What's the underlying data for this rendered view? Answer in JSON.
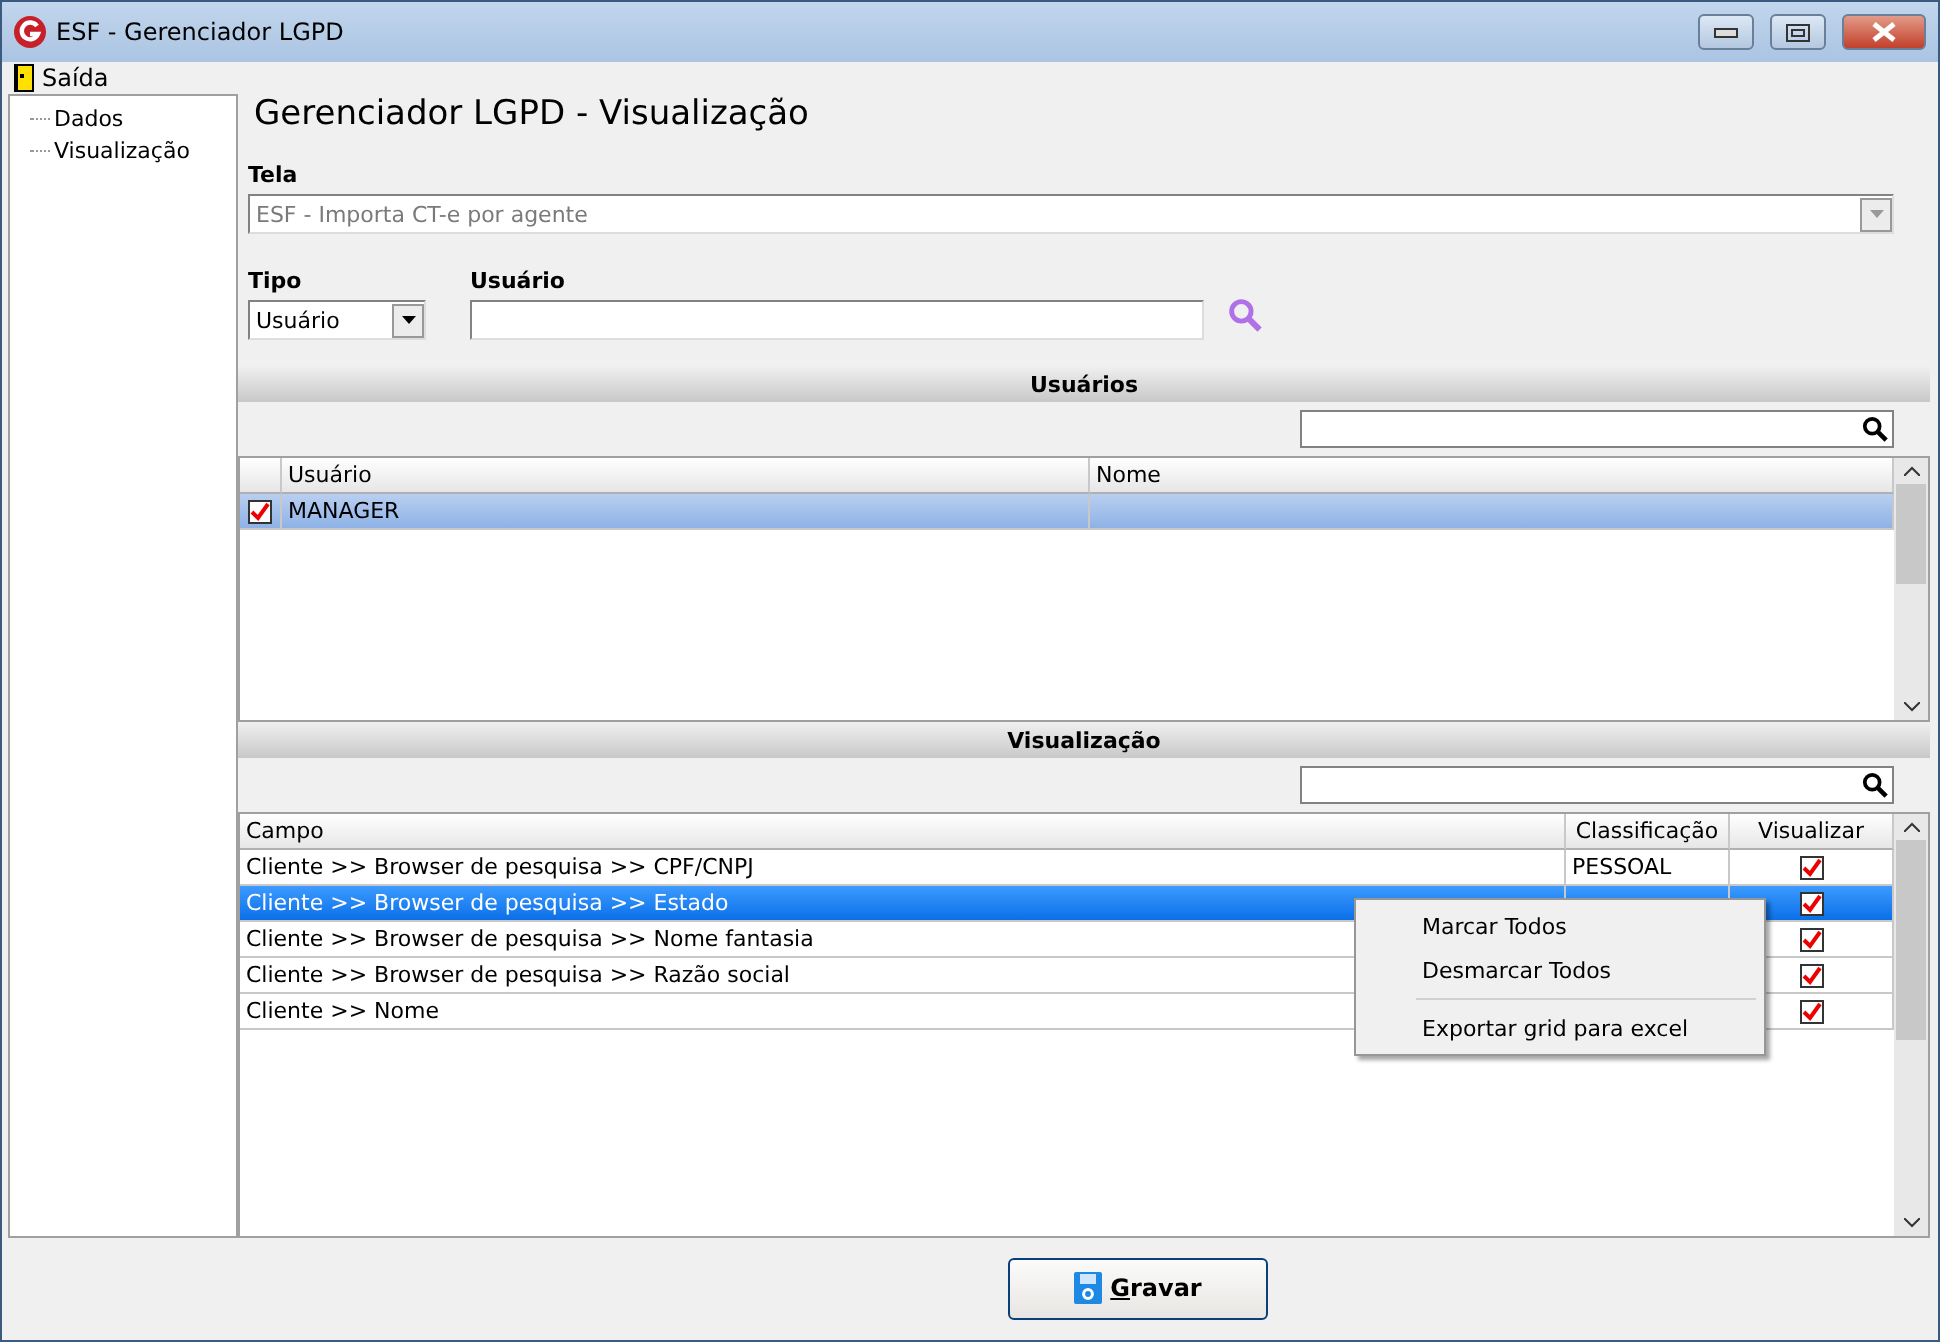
{
  "window": {
    "title": "ESF - Gerenciador LGPD"
  },
  "menu_bar": [
    {
      "label": "Saída"
    }
  ],
  "tree": [
    {
      "label": "Dados"
    },
    {
      "label": "Visualização"
    }
  ],
  "heading": "Gerenciador LGPD - Visualização",
  "tela": {
    "label": "Tela",
    "value": "ESF - Importa CT-e por agente",
    "disabled": true
  },
  "tipo": {
    "label": "Tipo",
    "value": "Usuário"
  },
  "usuario": {
    "label": "Usuário"
  },
  "users_section": {
    "title": "Usuários",
    "columns": [
      "Usuário",
      "Nome"
    ],
    "rows": [
      {
        "usuario": "MANAGER",
        "checked": true,
        "selected": true
      }
    ]
  },
  "view_section": {
    "title": "Visualização",
    "columns": [
      "Campo",
      "Classificação",
      "Visualizar"
    ],
    "rows": [
      {
        "campo": "Cliente >> Browser de pesquisa >> CPF/CNPJ",
        "classificacao": "PESSOAL",
        "visualizar": true,
        "selected": false
      },
      {
        "campo": "Cliente >> Browser de pesquisa >> Estado",
        "visualizar": true,
        "selected": true
      },
      {
        "campo": "Cliente >> Browser de pesquisa >> Nome fantasia",
        "visualizar": true,
        "selected": false
      },
      {
        "campo": "Cliente >> Browser de pesquisa >> Razão social",
        "visualizar": true,
        "selected": false
      },
      {
        "campo": "Cliente >> Nome",
        "visualizar": true,
        "selected": false
      }
    ]
  },
  "context_menu": [
    {
      "kind": "item",
      "label": "Marcar Todos"
    },
    {
      "kind": "item",
      "label": "Desmarcar Todos"
    },
    {
      "kind": "separator"
    },
    {
      "kind": "item",
      "label": "Exportar grid para excel"
    }
  ],
  "save_button": {
    "label": "Gravar"
  }
}
